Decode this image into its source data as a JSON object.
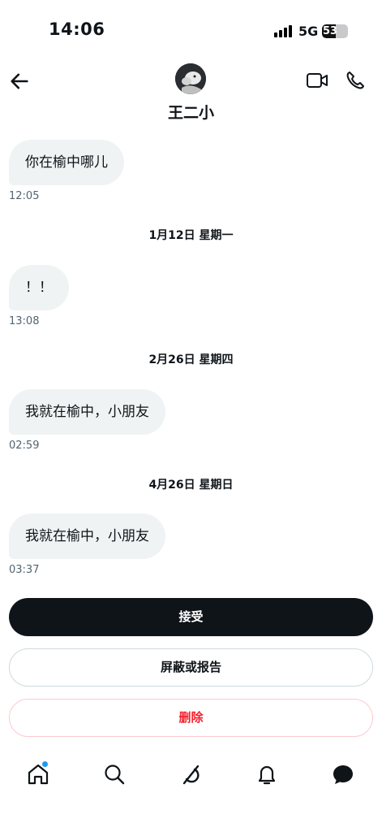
{
  "status_bar": {
    "time": "14:06",
    "network": "5G",
    "battery": "53",
    "battery_level_percent": 53
  },
  "header": {
    "contact_name": "王二小",
    "avatar_icon": "profile-photo"
  },
  "messages": [
    {
      "text": "你在榆中哪儿",
      "time": "12:05"
    },
    {
      "text": "！！",
      "time": "13:08"
    },
    {
      "text": "我就在榆中，小朋友",
      "time": "02:59"
    },
    {
      "text": "我就在榆中，小朋友",
      "time": "03:37"
    }
  ],
  "date_separators": [
    "1月12日 星期一",
    "2月26日 星期四",
    "4月26日 星期日"
  ],
  "actions": {
    "accept": "接受",
    "block_report": "屏蔽或报告",
    "delete": "删除"
  },
  "tabs": [
    {
      "name": "home",
      "icon": "home-icon",
      "has_notification_dot": true
    },
    {
      "name": "search",
      "icon": "search-icon"
    },
    {
      "name": "grok",
      "icon": "grok-icon"
    },
    {
      "name": "notifications",
      "icon": "bell-icon"
    },
    {
      "name": "messages",
      "icon": "messages-icon"
    }
  ],
  "colors": {
    "accent_blue": "#1d9bf0",
    "delete_red": "#f4212e",
    "bubble_gray": "#eff3f4",
    "time_gray": "#536471",
    "primary_dark": "#0f1419"
  }
}
